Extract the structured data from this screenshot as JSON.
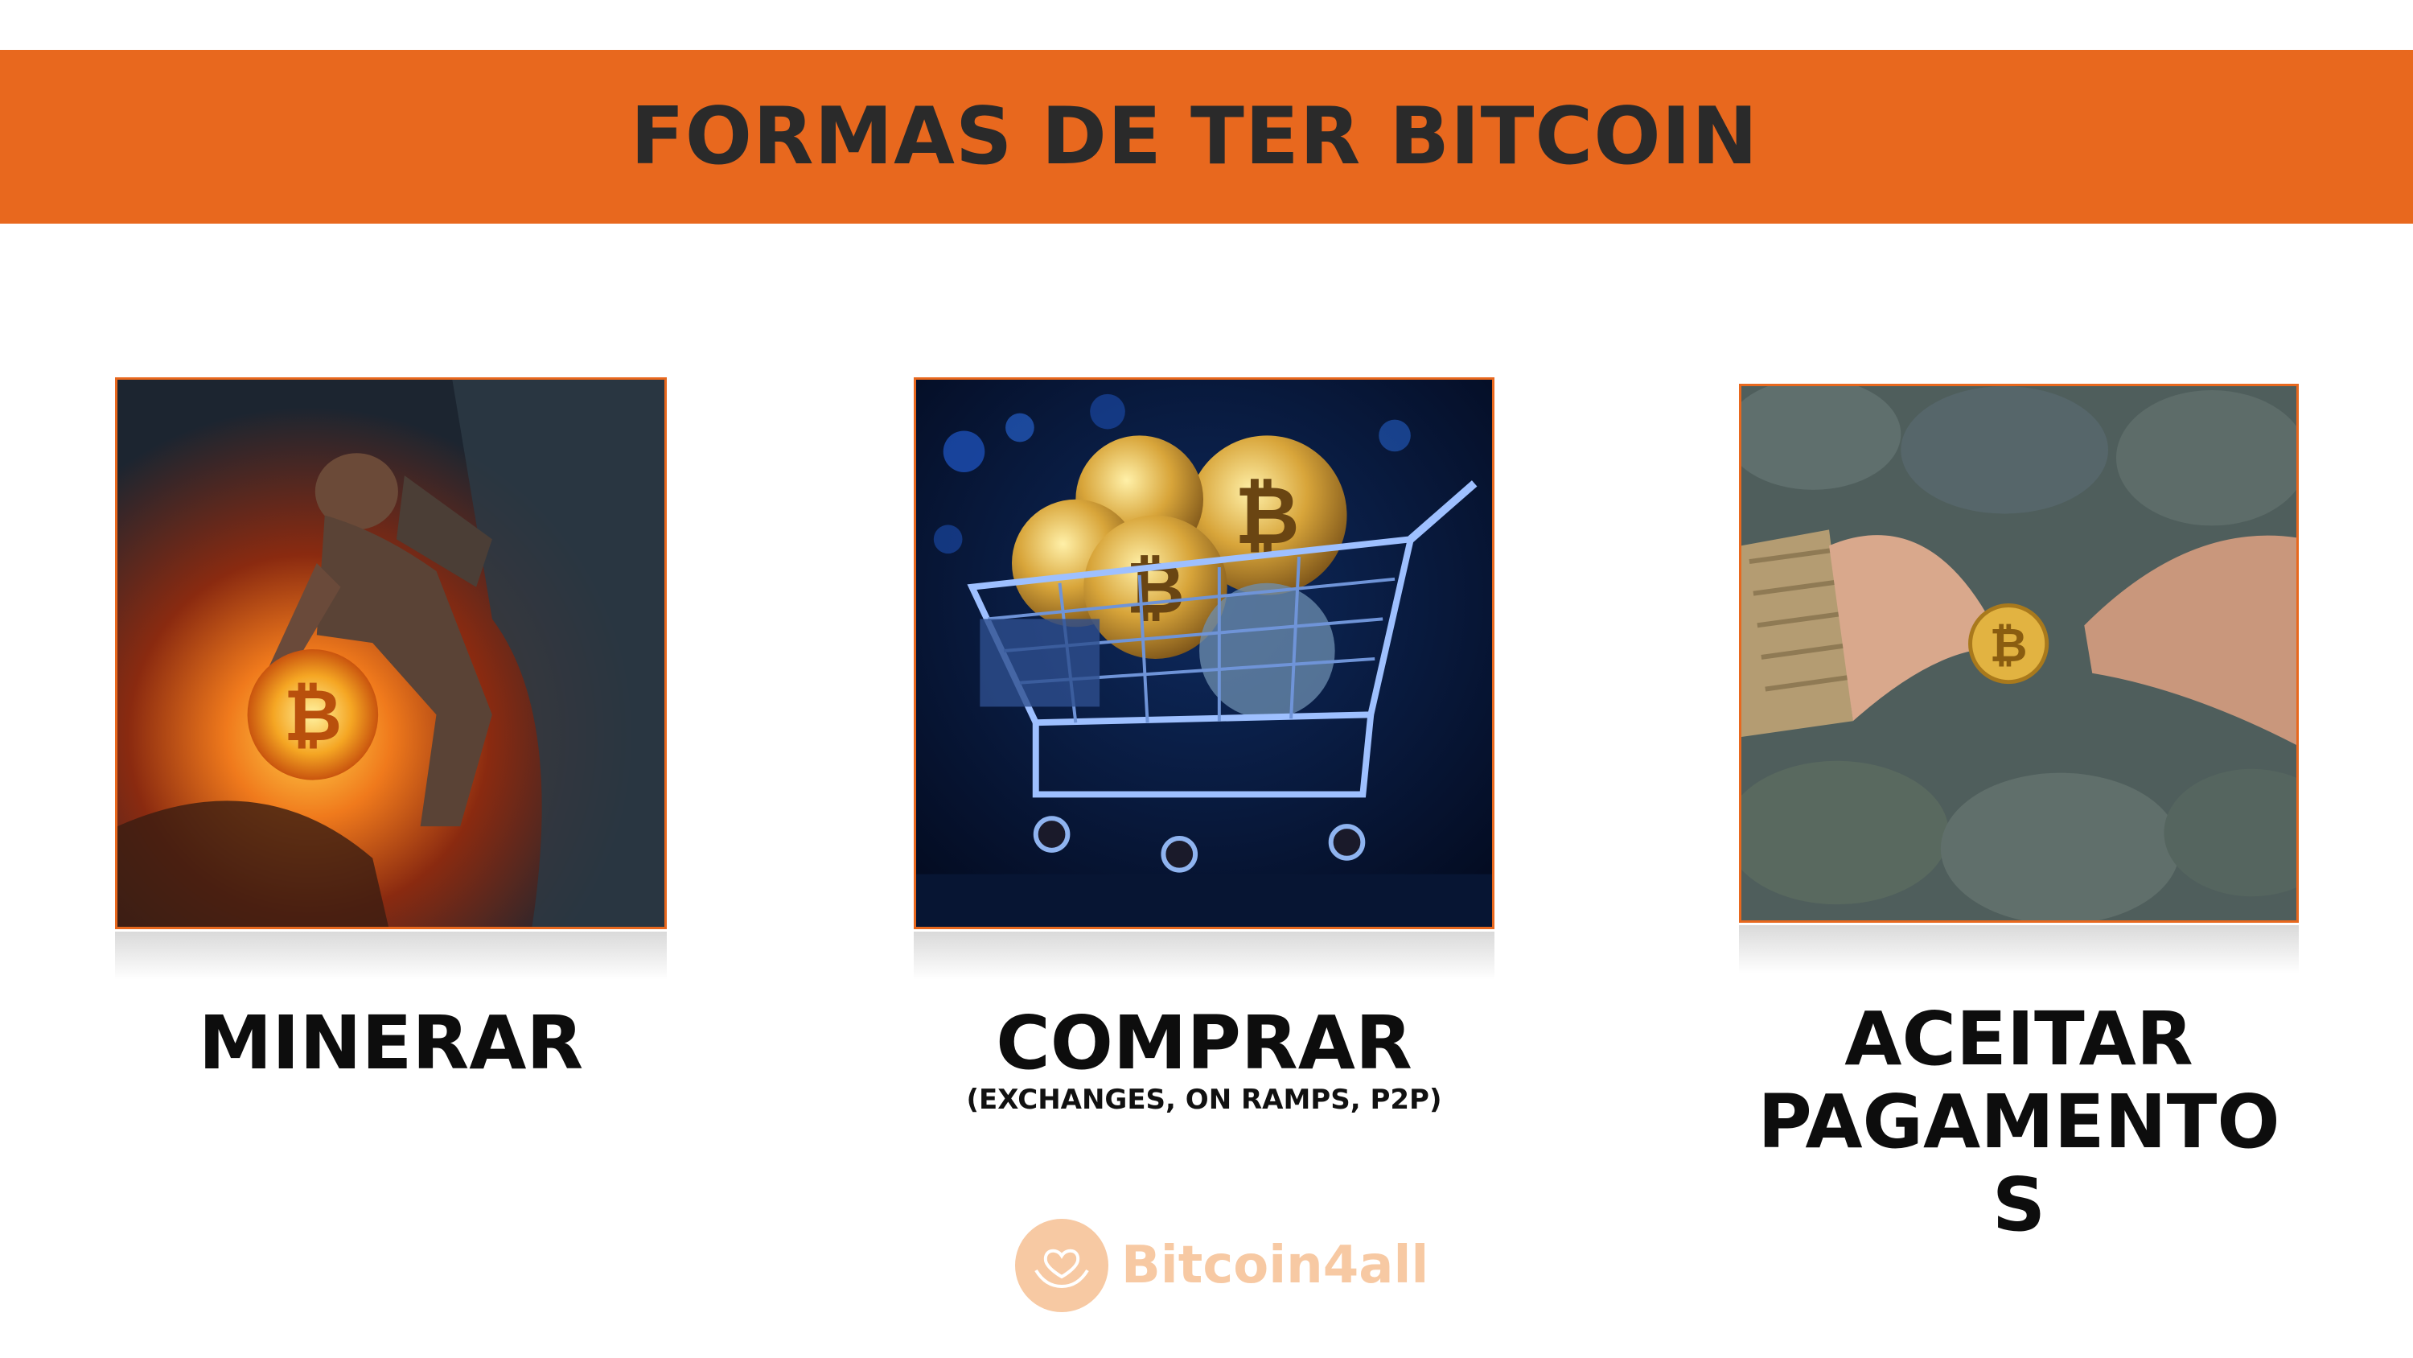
{
  "header": {
    "title": "FORMAS DE TER BITCOIN",
    "background_color": "#E8681E"
  },
  "cards": [
    {
      "image": "miner-with-glowing-bitcoin-illustration",
      "label": "MINERAR",
      "sublabel": ""
    },
    {
      "image": "shopping-cart-full-of-bitcoins-illustration",
      "label": "COMPRAR",
      "sublabel": "(EXCHANGES, ON RAMPS, P2P)"
    },
    {
      "image": "hands-exchanging-bitcoin-coin-photo",
      "label_line1": "ACEITAR",
      "label_line2": "PAGAMENTO S"
    }
  ],
  "logo": {
    "text": "Bitcoin4all",
    "icon": "hands-heart-icon",
    "color": "#F7C9A3"
  }
}
